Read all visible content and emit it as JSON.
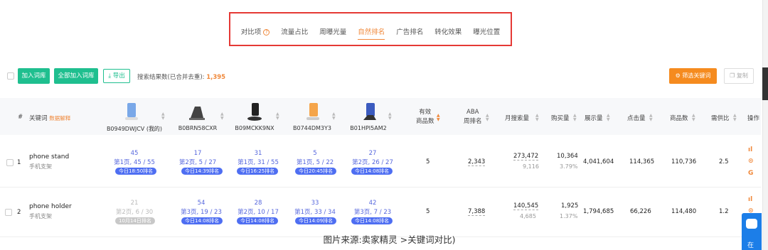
{
  "tabs": {
    "items": [
      "对比项",
      "流量占比",
      "周曝光量",
      "自然排名",
      "广告排名",
      "转化效果",
      "曝光位置"
    ],
    "active_index": 3,
    "help_icon": "?"
  },
  "toolbar": {
    "add_lexicon": "加入词库",
    "add_all_lexicon": "全部加入词库",
    "export": "导出",
    "result_label": "搜索结果数(已合并去重):",
    "result_count": "1,395",
    "filter_keywords": "筛选关键词",
    "copy": "复制"
  },
  "table": {
    "headers": {
      "index": "#",
      "keyword": "关键词",
      "data_explain": "数据解释",
      "valid_products_1": "有效",
      "valid_products_2": "商品数",
      "aba_1": "ABA",
      "aba_2": "周排名",
      "monthly_search": "月搜索量",
      "purchase": "购买量",
      "impressions": "展示量",
      "clicks": "点击量",
      "products": "商品数",
      "supply_ratio": "需供比",
      "action": "操作"
    },
    "asins": [
      "B0949DWJCV (我的)",
      "B0BRN58CXR",
      "B09MCKK9NX",
      "B0744DM3Y3",
      "B01HPI5AM2"
    ],
    "rows": [
      {
        "index": "1",
        "keyword": "phone stand",
        "keyword_cn": "手机支架",
        "ranks": [
          {
            "top": "45",
            "bottom": "第1页, 45 / 55",
            "tag": "今日18:50排名"
          },
          {
            "top": "17",
            "bottom": "第2页, 5 / 27",
            "tag": "今日14:39排名"
          },
          {
            "top": "31",
            "bottom": "第1页, 31 / 55",
            "tag": "今日16:25排名"
          },
          {
            "top": "5",
            "bottom": "第1页, 5 / 22",
            "tag": "今日20:45排名"
          },
          {
            "top": "27",
            "bottom": "第2页, 26 / 27",
            "tag": "今日14:08排名"
          }
        ],
        "valid_products": "5",
        "aba": "2,343",
        "monthly_search": "273,472",
        "monthly_search_sub": "9,116",
        "purchase": "10,364",
        "purchase_pct": "3.79%",
        "impressions": "4,041,604",
        "clicks": "114,365",
        "products": "110,736",
        "supply_ratio": "2.5"
      },
      {
        "index": "2",
        "keyword": "phone holder",
        "keyword_cn": "手机支架",
        "ranks": [
          {
            "top": "21",
            "bottom": "第2页, 6 / 30",
            "tag": "10月14日排名",
            "gray": true
          },
          {
            "top": "54",
            "bottom": "第3页, 19 / 23",
            "tag": "今日14:08排名"
          },
          {
            "top": "28",
            "bottom": "第2页, 10 / 17",
            "tag": "今日14:08排名"
          },
          {
            "top": "33",
            "bottom": "第1页, 33 / 34",
            "tag": "今日14:09排名"
          },
          {
            "top": "42",
            "bottom": "第3页, 7 / 23",
            "tag": "今日14:08排名"
          }
        ],
        "valid_products": "5",
        "aba": "7,388",
        "monthly_search": "140,545",
        "monthly_search_sub": "4,685",
        "purchase": "1,925",
        "purchase_pct": "1.37%",
        "impressions": "1,794,685",
        "clicks": "66,226",
        "products": "114,480",
        "supply_ratio": "1.2"
      }
    ]
  },
  "actions": {
    "chart_icon": "bar-chart-icon",
    "more_icon": "more-icon",
    "google_icon": "G"
  },
  "caption": "图片来源:卖家精灵 >关键词对比)",
  "side_chat_text": "在",
  "colors": {
    "accent": "#f0883a",
    "green": "#1fbf8f",
    "blue": "#4e6ef2",
    "frame": "#e53935"
  }
}
